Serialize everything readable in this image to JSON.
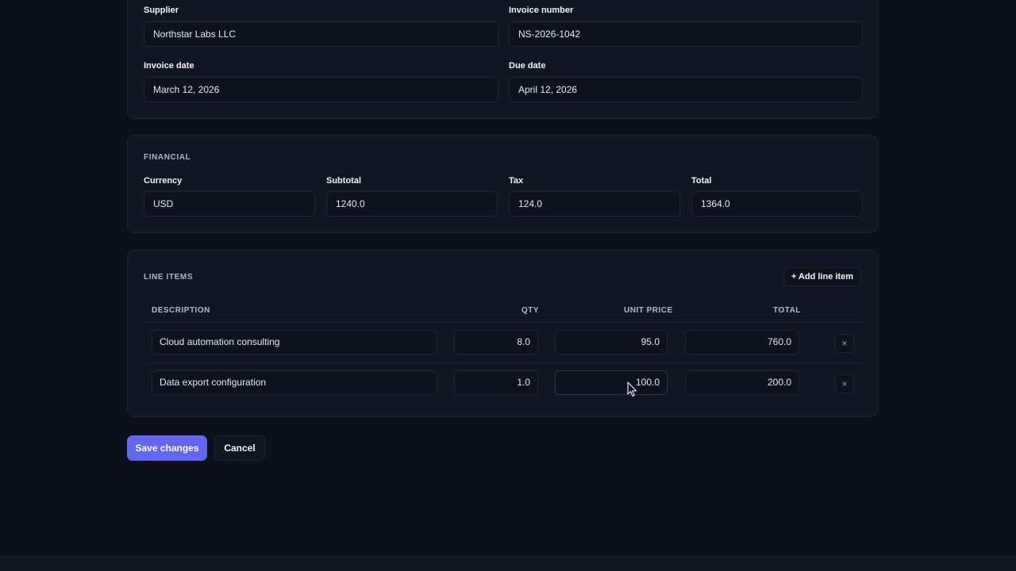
{
  "details": {
    "supplier_label": "Supplier",
    "supplier_value": "Northstar Labs LLC",
    "invoice_number_label": "Invoice number",
    "invoice_number_value": "NS-2026-1042",
    "invoice_date_label": "Invoice date",
    "invoice_date_value": "March 12, 2026",
    "due_date_label": "Due date",
    "due_date_value": "April 12, 2026"
  },
  "financial": {
    "section_title": "FINANCIAL",
    "currency_label": "Currency",
    "currency_value": "USD",
    "subtotal_label": "Subtotal",
    "subtotal_value": "1240.0",
    "tax_label": "Tax",
    "tax_value": "124.0",
    "total_label": "Total",
    "total_value": "1364.0"
  },
  "line_items": {
    "section_title": "LINE ITEMS",
    "add_label": "+ Add line item",
    "columns": {
      "description": "DESCRIPTION",
      "qty": "QTY",
      "unit_price": "UNIT PRICE",
      "total": "TOTAL"
    },
    "rows": [
      {
        "description": "Cloud automation consulting",
        "qty": "8.0",
        "unit_price": "95.0",
        "total": "760.0",
        "remove": "×"
      },
      {
        "description": "Data export configuration",
        "qty": "1.0",
        "unit_price": "100.0",
        "total": "200.0",
        "remove": "×"
      }
    ]
  },
  "actions": {
    "save_label": "Save changes",
    "cancel_label": "Cancel"
  },
  "colors": {
    "background": "#0c1019",
    "card": "#111722",
    "accent": "#6366f1"
  },
  "icons": {
    "cursor": "mouse-pointer-icon",
    "remove": "close-icon"
  }
}
